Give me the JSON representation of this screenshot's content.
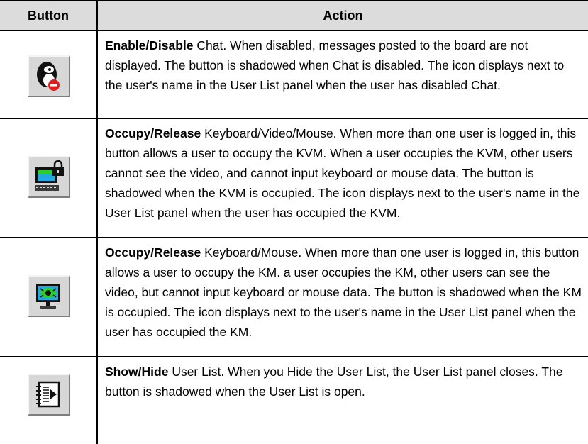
{
  "table": {
    "headers": {
      "button": "Button",
      "action": "Action"
    },
    "rows": [
      {
        "icon": "chat-disable-icon",
        "title": "Enable/Disable",
        "text": " Chat. When disabled, messages posted to the board are not displayed. The button is shadowed when Chat is disabled. The icon displays next to the user's name in the User List panel when the user has disabled Chat."
      },
      {
        "icon": "kvm-occupy-icon",
        "title": "Occupy/Release",
        "text": " Keyboard/Video/Mouse. When more than one user is logged in, this button allows a user to occupy the KVM. When a user occupies the KVM, other users cannot see the video, and cannot input keyboard or mouse data. The button is shadowed when the KVM is occupied. The icon displays next to the user's name in the User List panel when the user has occupied the KVM."
      },
      {
        "icon": "km-occupy-icon",
        "title": "Occupy/Release",
        "text": " Keyboard/Mouse. When more than one user is logged in, this button allows a user to occupy the KM. a user occupies the KM, other users can see the video, but cannot input keyboard or mouse data. The button is shadowed when the KM is occupied. The icon displays next to the user's name in the User List panel when the user has occupied the KM."
      },
      {
        "icon": "user-list-icon",
        "title": "Show/Hide",
        "text": " User List. When you Hide the User List, the User List panel closes. The button is shadowed when the User List is open."
      }
    ]
  }
}
